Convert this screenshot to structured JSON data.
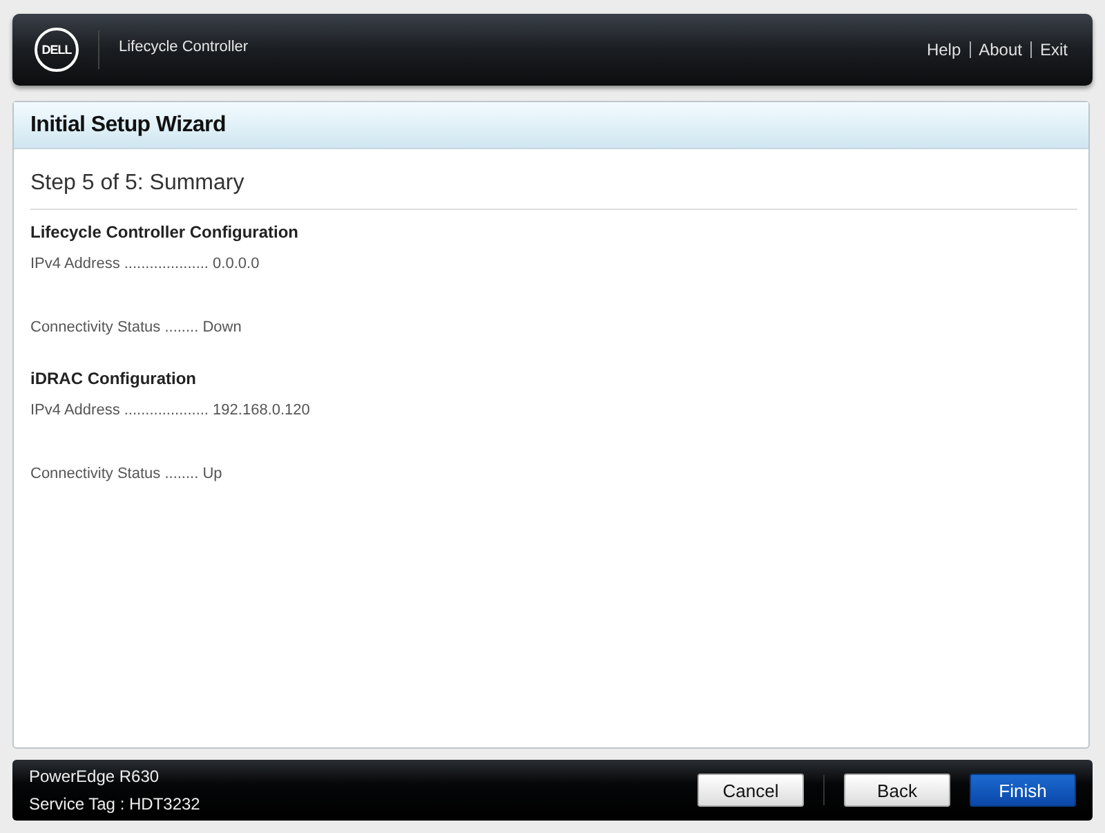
{
  "header": {
    "logo": "DELL",
    "product": "Lifecycle Controller",
    "links": [
      "Help",
      "About",
      "Exit"
    ]
  },
  "wizard": {
    "title": "Initial Setup Wizard",
    "step": "Step 5 of 5: Summary",
    "sections": [
      {
        "heading": "Lifecycle Controller Configuration",
        "lines": [
          "IPv4 Address .................... 0.0.0.0",
          "Connectivity Status ........ Down"
        ]
      },
      {
        "heading": "iDRAC Configuration",
        "lines": [
          "IPv4 Address .................... 192.168.0.120",
          "Connectivity Status ........ Up"
        ]
      }
    ]
  },
  "footer": {
    "model": "PowerEdge R630",
    "service_tag": "Service Tag : HDT3232",
    "buttons": [
      {
        "label": "Cancel",
        "kind": "secondary"
      },
      {
        "label": "Back",
        "kind": "secondary"
      },
      {
        "label": "Finish",
        "kind": "primary"
      }
    ]
  }
}
